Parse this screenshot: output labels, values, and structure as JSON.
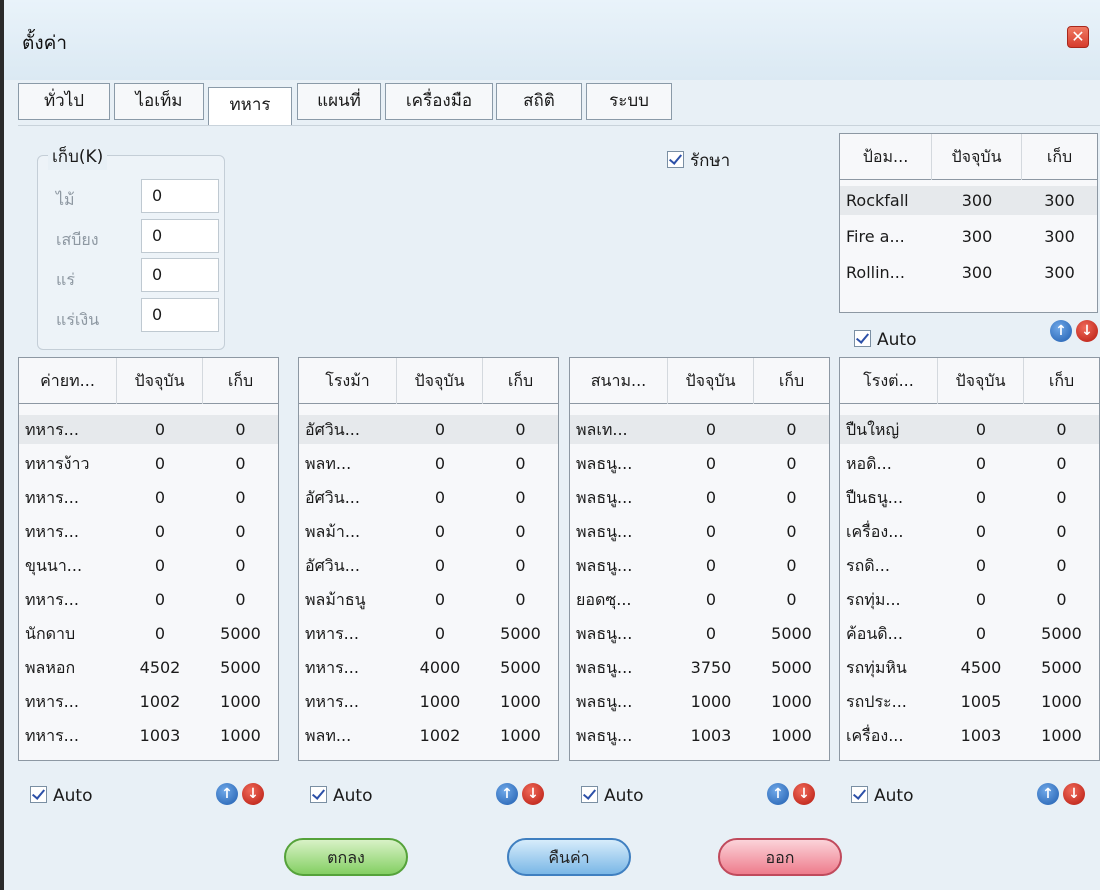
{
  "window": {
    "title": "ตั้งค่า"
  },
  "tabs": [
    "ทั่วไป",
    "ไอเท็ม",
    "ทหาร",
    "แผนที่",
    "เครื่องมือ",
    "สถิติ",
    "ระบบ"
  ],
  "active_tab": "ทหาร",
  "stock": {
    "legend": "เก็บ(K)",
    "rows": [
      {
        "label": "ไม้",
        "value": "0"
      },
      {
        "label": "เสบียง",
        "value": "0"
      },
      {
        "label": "แร่",
        "value": "0"
      },
      {
        "label": "แร่เงิน",
        "value": "0"
      }
    ]
  },
  "guard": {
    "label": "รักษา",
    "checked": true
  },
  "defense": {
    "headers": [
      "ป้อม...",
      "ปัจจุบัน",
      "เก็บ"
    ],
    "rows": [
      [
        "Rockfall",
        "300",
        "300"
      ],
      [
        "Fire a...",
        "300",
        "300"
      ],
      [
        "Rollin...",
        "300",
        "300"
      ]
    ],
    "auto_label": "Auto",
    "auto_checked": true
  },
  "panels": [
    {
      "headers": [
        "ค่ายท...",
        "ปัจจุบัน",
        "เก็บ"
      ],
      "rows": [
        [
          "ทหาร...",
          "0",
          "0"
        ],
        [
          "ทหารง้าว",
          "0",
          "0"
        ],
        [
          "ทหาร...",
          "0",
          "0"
        ],
        [
          "ทหาร...",
          "0",
          "0"
        ],
        [
          "ขุนนา...",
          "0",
          "0"
        ],
        [
          "ทหาร...",
          "0",
          "0"
        ],
        [
          "นักดาบ",
          "0",
          "5000"
        ],
        [
          "พลหอก",
          "4502",
          "5000"
        ],
        [
          "ทหาร...",
          "1002",
          "1000"
        ],
        [
          "ทหาร...",
          "1003",
          "1000"
        ]
      ],
      "auto_label": "Auto"
    },
    {
      "headers": [
        "โรงม้า",
        "ปัจจุบัน",
        "เก็บ"
      ],
      "rows": [
        [
          "อัศวิน...",
          "0",
          "0"
        ],
        [
          "พลท...",
          "0",
          "0"
        ],
        [
          "อัศวิน...",
          "0",
          "0"
        ],
        [
          "พลม้า...",
          "0",
          "0"
        ],
        [
          "อัศวิน...",
          "0",
          "0"
        ],
        [
          "พลม้าธนู",
          "0",
          "0"
        ],
        [
          "ทหาร...",
          "0",
          "5000"
        ],
        [
          "ทหาร...",
          "4000",
          "5000"
        ],
        [
          "ทหาร...",
          "1000",
          "1000"
        ],
        [
          "พลท...",
          "1002",
          "1000"
        ]
      ],
      "auto_label": "Auto"
    },
    {
      "headers": [
        "สนาม...",
        "ปัจจุบัน",
        "เก็บ"
      ],
      "rows": [
        [
          "พลเท...",
          "0",
          "0"
        ],
        [
          "พลธนู...",
          "0",
          "0"
        ],
        [
          "พลธนู...",
          "0",
          "0"
        ],
        [
          "พลธนู...",
          "0",
          "0"
        ],
        [
          "พลธนู...",
          "0",
          "0"
        ],
        [
          "ยอดซุ...",
          "0",
          "0"
        ],
        [
          "พลธนู...",
          "0",
          "5000"
        ],
        [
          "พลธนู...",
          "3750",
          "5000"
        ],
        [
          "พลธนู...",
          "1000",
          "1000"
        ],
        [
          "พลธนู...",
          "1003",
          "1000"
        ]
      ],
      "auto_label": "Auto"
    },
    {
      "headers": [
        "โรงต่...",
        "ปัจจุบัน",
        "เก็บ"
      ],
      "rows": [
        [
          "ปืนใหญ่",
          "0",
          "0"
        ],
        [
          "หอดิ...",
          "0",
          "0"
        ],
        [
          "ปืนธนู...",
          "0",
          "0"
        ],
        [
          "เครื่อง...",
          "0",
          "0"
        ],
        [
          "รถดิ...",
          "0",
          "0"
        ],
        [
          "รถทุ่ม...",
          "0",
          "0"
        ],
        [
          "ค้อนดิ...",
          "0",
          "5000"
        ],
        [
          "รถทุ่มหิน",
          "4500",
          "5000"
        ],
        [
          "รถประ...",
          "1005",
          "1000"
        ],
        [
          "เครื่อง...",
          "1003",
          "1000"
        ]
      ],
      "auto_label": "Auto"
    }
  ],
  "buttons": {
    "ok": "ตกลง",
    "reset": "คืนค่า",
    "exit": "ออก"
  },
  "icons": {
    "up": "arrow-up-icon",
    "down": "arrow-down-icon",
    "close": "close-icon"
  },
  "colors": {
    "up_arrow": "#1e5cae",
    "down_arrow": "#b5180e",
    "ok": "#84cf63",
    "reset": "#7ab7e6",
    "exit": "#ee7c8c"
  }
}
